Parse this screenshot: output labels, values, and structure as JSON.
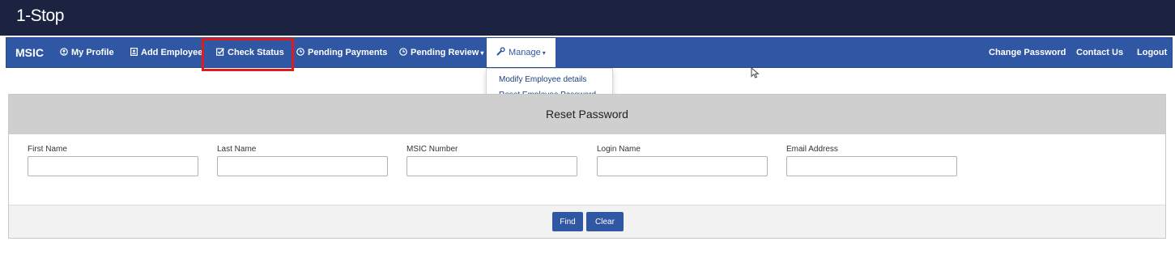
{
  "brand": {
    "logo_text": "1-Stop"
  },
  "navbar": {
    "brand_label": "MSIC",
    "items": [
      {
        "label": "My Profile",
        "icon": "user-circle-icon"
      },
      {
        "label": "Add Employee",
        "icon": "id-card-icon"
      },
      {
        "label": "Check Status",
        "icon": "check-square-icon"
      },
      {
        "label": "Pending Payments",
        "icon": "clock-icon"
      },
      {
        "label": "Pending Review",
        "icon": "clock-icon",
        "dropdown": true
      },
      {
        "label": "Manage",
        "icon": "wrench-icon",
        "dropdown": true,
        "active": true
      }
    ],
    "right_items": [
      {
        "label": "Change Password"
      },
      {
        "label": "Contact Us"
      },
      {
        "label": "Logout"
      }
    ],
    "color": "#2f57a4"
  },
  "manage_dropdown": {
    "items": [
      {
        "label": "Modify Employee details"
      },
      {
        "label": "Reset Employee Password"
      }
    ]
  },
  "panel": {
    "title": "Reset Password",
    "fields": [
      {
        "label": "First Name",
        "value": ""
      },
      {
        "label": "Last Name",
        "value": ""
      },
      {
        "label": "MSIC Number",
        "value": ""
      },
      {
        "label": "Login Name",
        "value": ""
      },
      {
        "label": "Email Address",
        "value": ""
      }
    ],
    "buttons": {
      "find": "Find",
      "clear": "Clear"
    }
  },
  "colors": {
    "header_bg": "#1c2340",
    "accent": "#2f57a4",
    "highlight": "#e01b1b"
  }
}
